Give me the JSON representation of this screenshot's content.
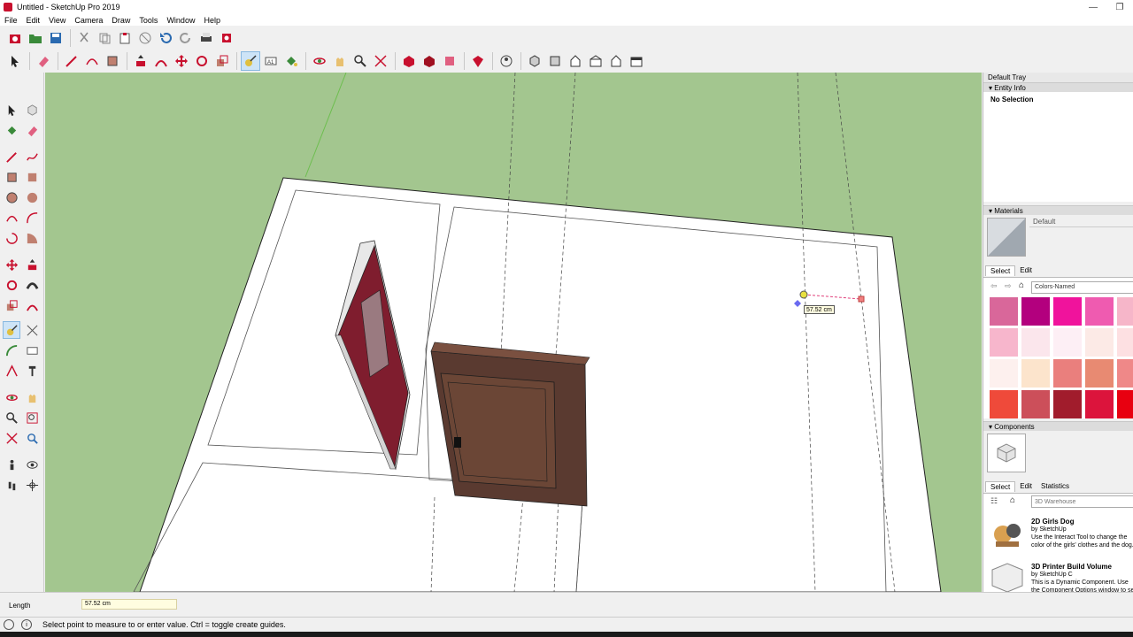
{
  "window": {
    "title": "Untitled - SketchUp Pro 2019"
  },
  "menu": [
    "File",
    "Edit",
    "View",
    "Camera",
    "Draw",
    "Tools",
    "Window",
    "Help"
  ],
  "tray": {
    "title": "Default Tray",
    "entity_info": {
      "header": "Entity Info",
      "selection": "No Selection"
    },
    "materials": {
      "header": "Materials",
      "current": "Default",
      "tab_select": "Select",
      "tab_edit": "Edit",
      "library": "Colors-Named",
      "swatches": [
        "#d9679a",
        "#b3007e",
        "#f0139c",
        "#ef5bb0",
        "#f6b6c9",
        "#f7b6cc",
        "#fbe6ec",
        "#fdeff5",
        "#fceae6",
        "#fde0e2",
        "#fdf0ee",
        "#fce4cc",
        "#ea7f7d",
        "#e88a72",
        "#ef8888",
        "#ef4a3a",
        "#cc4f5a",
        "#a11c2c",
        "#dc143c",
        "#e80010"
      ]
    },
    "components": {
      "header": "Components",
      "tab_select": "Select",
      "tab_edit": "Edit",
      "tab_statistics": "Statistics",
      "search_placeholder": "3D Warehouse",
      "items": [
        {
          "name": "2D Girls Dog",
          "author": "by SketchUp",
          "desc": "Use the Interact Tool to change the color of the girls' clothes and the dog."
        },
        {
          "name": "3D Printer Build Volume",
          "author": "by SketchUp C",
          "desc": "This is a Dynamic Component. Use the Component Options window to se"
        }
      ]
    }
  },
  "viewport": {
    "tooltip": "57.52 cm"
  },
  "measurements": {
    "label": "Length",
    "value": "57.52 cm"
  },
  "status": {
    "message": "Select point to measure to or enter value.  Ctrl = toggle create guides."
  },
  "colors": {
    "sky": "#a3c68f",
    "door_red": "#7f1d2e",
    "door_wood": "#5a3a30",
    "guide_pink": "#e0407a"
  }
}
